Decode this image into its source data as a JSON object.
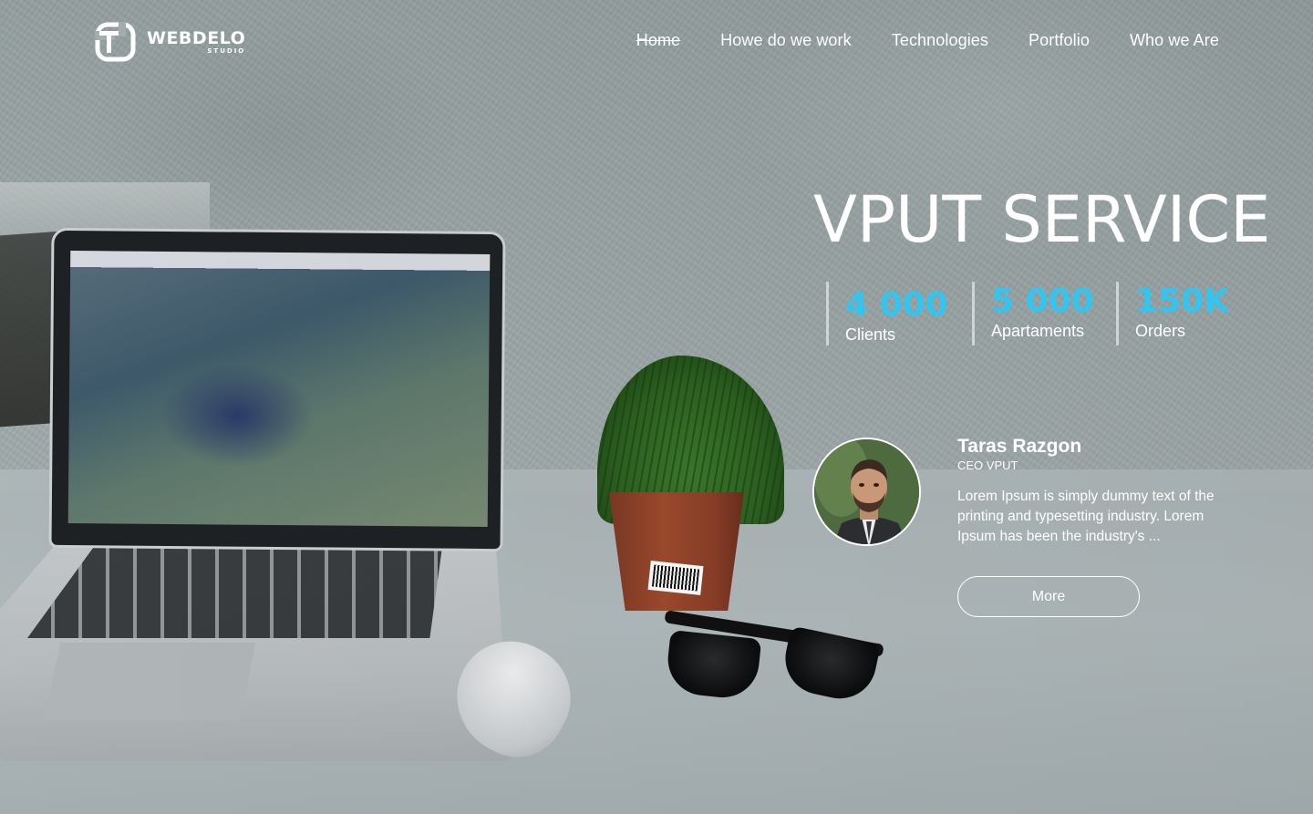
{
  "brand": {
    "name": "WEBDELO",
    "subtitle": "STUDIO"
  },
  "nav": {
    "items": [
      {
        "label": "Home",
        "active": true
      },
      {
        "label": "Howe do we work",
        "active": false
      },
      {
        "label": "Technologies",
        "active": false
      },
      {
        "label": "Portfolio",
        "active": false
      },
      {
        "label": "Who we Are",
        "active": false
      }
    ]
  },
  "hero": {
    "title": "VPUT SERVICE",
    "stats": [
      {
        "value": "4 000",
        "label": "Clients"
      },
      {
        "value": "5 000",
        "label": "Apartaments"
      },
      {
        "value": "150K",
        "label": "Orders"
      }
    ]
  },
  "testimonial": {
    "name": "Taras Razgon",
    "role": "CEO VPUT",
    "text": "Lorem Ipsum is simply dummy text of the printing and typesetting industry. Lorem Ipsum has been the industry's ...",
    "button_label": "More"
  },
  "colors": {
    "accent": "#31c6f1",
    "text": "#ffffff"
  },
  "icons": {
    "logo": "webdelo-logo-icon"
  }
}
